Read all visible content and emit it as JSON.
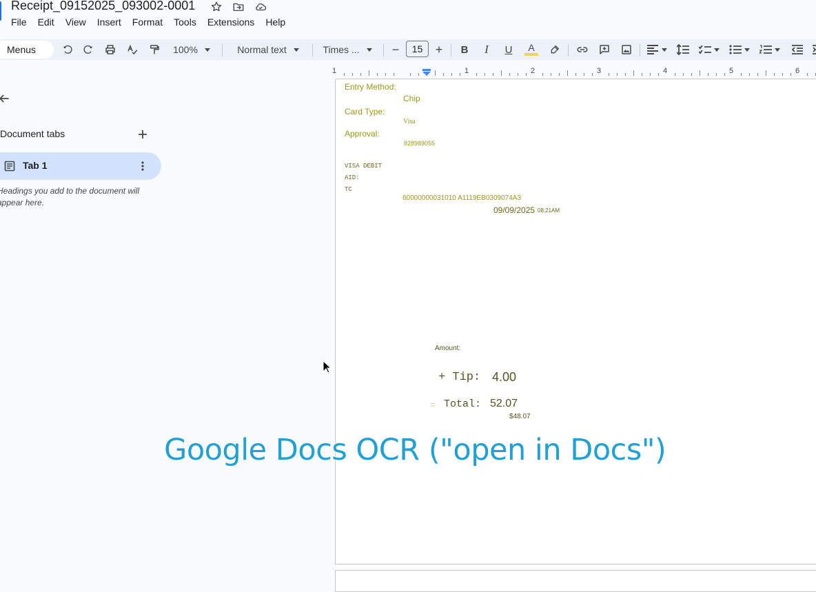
{
  "window": {
    "title": "Receipt_09152025_093002-0001",
    "title_icons": [
      "star-icon",
      "move-to-folder-icon",
      "cloud-saved-icon"
    ]
  },
  "menubar": [
    "File",
    "Edit",
    "View",
    "Insert",
    "Format",
    "Tools",
    "Extensions",
    "Help"
  ],
  "toolbar": {
    "menus_label": "Menus",
    "zoom": "100%",
    "style": "Normal text",
    "font": "Times ...",
    "font_size": "15",
    "minus": "−",
    "plus": "+",
    "bold": "B",
    "italic": "I",
    "underline": "U",
    "text_color_letter": "A",
    "text_color_accent": "#f0d25e"
  },
  "ruler": {
    "numbers": [
      "1",
      "1",
      "2",
      "3",
      "4",
      "5",
      "6"
    ]
  },
  "sidebar": {
    "heading": "Document tabs",
    "tabs": [
      {
        "label": "Tab 1"
      }
    ],
    "hint": "Headings you add to the document will appear here."
  },
  "document": {
    "entry_method_label": "Entry Method:",
    "entry_method_value": "Chip",
    "card_type_label": "Card Type:",
    "card_type_value": "Visa",
    "approval_label": "Approval:",
    "approval_value": "828989055",
    "visa_debit": "VISA DEBIT",
    "aid_label": "AID:",
    "tc_label": "TC",
    "aid_tc_value": "60000000031010 A1119EB0309074A3",
    "date": "09/09/2025",
    "time": "08:21AM",
    "amount_label": "Amount:",
    "tip_prefix": "+ Tip:",
    "tip_value": "4.00",
    "total_eq": "=",
    "total_label": "Total:",
    "total_value": "52.07",
    "subtotal": "$48.07",
    "text_color": "#9a9a1a"
  },
  "overlay": {
    "caption": "Google Docs OCR (\"open in Docs\")",
    "color": "#1fa1d6"
  }
}
